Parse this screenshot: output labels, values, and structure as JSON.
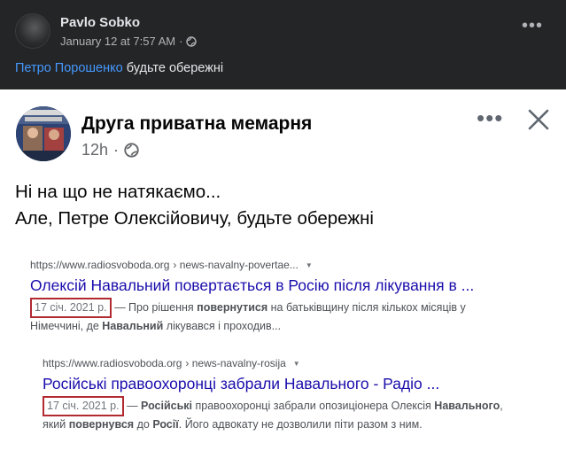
{
  "post": {
    "author": "Pavlo Sobko",
    "timestamp": "January 12 at 7:57 AM",
    "separator": "·",
    "mention": "Петро Порошенко",
    "text": "будьте обережні",
    "more_label": "•••",
    "privacy_icon": "globe-icon"
  },
  "shared": {
    "page_name": "Друга приватна мемарня",
    "time": "12h",
    "separator": "·",
    "more_label": "•••",
    "body_line1": "Ні на що не натякаємо...",
    "body_line2": "Але, Петре Олексійовичу, будьте обережні",
    "results": [
      {
        "url": "https://www.radiosvoboda.org",
        "path": "› news-navalny-povertae...",
        "title": "Олексій Навальний повертається в Росію після лікування в ...",
        "date": "17 січ. 2021 р.",
        "dash": "—",
        "snippet_a": "Про рішення ",
        "snippet_b": "повернутися",
        "snippet_c": " на батьківщину після кількох місяців у",
        "snippet_d": "Німеччині, де ",
        "snippet_e": "Навальний",
        "snippet_f": " лікувався і проходив..."
      },
      {
        "url": "https://www.radiosvoboda.org",
        "path": "› news-navalny-rosija",
        "title": "Російські правоохоронці забрали Навального - Радіо ...",
        "date": "17 січ. 2021 р.",
        "dash": "—",
        "snippet_a": "Російські",
        "snippet_b": " правоохоронці забрали опозиціонера Олексія ",
        "snippet_c": "Навального",
        "snippet_d": ",",
        "snippet_e": "який ",
        "snippet_f": "повернувся",
        "snippet_g": " до ",
        "snippet_h": "Росії",
        "snippet_i": ". Його адвокату не дозволили піти разом з ним."
      }
    ]
  },
  "colors": {
    "header_bg": "#242526",
    "mention": "#4599ff",
    "link_title": "#1a0dab",
    "date_box": "#b12a30"
  }
}
